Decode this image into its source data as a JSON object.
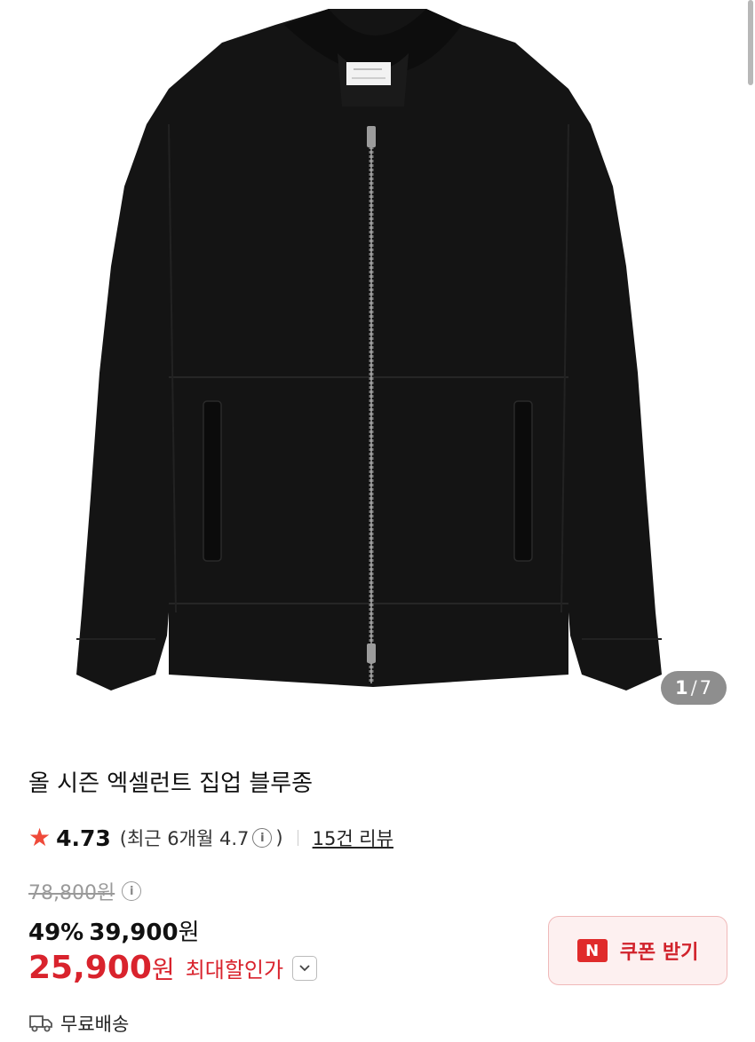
{
  "gallery": {
    "current": "1",
    "separator": "/",
    "total": "7",
    "image_alt_icon": "black-zip-bomber-jacket"
  },
  "product": {
    "title": "올 시즌 엑셀런트 집업 블루종"
  },
  "rating": {
    "star_icon": "★",
    "score": "4.73",
    "recent_prefix": "(최근 6개월 4.7",
    "recent_suffix": ")",
    "info_icon": "i",
    "reviews_link": "15건 리뷰"
  },
  "price": {
    "original": "78,800원",
    "info_icon": "i",
    "discount_rate": "49%",
    "sale_value": "39,900",
    "sale_unit": "원",
    "best_value": "25,900",
    "best_unit": "원",
    "best_label": "최대할인가"
  },
  "coupon": {
    "badge": "N",
    "label": "쿠폰 받기"
  },
  "shipping": {
    "label": "무료배송"
  },
  "colors": {
    "accent_red": "#d9232d",
    "star": "#ef4a3a",
    "coupon_bg": "#fdf0f0"
  }
}
